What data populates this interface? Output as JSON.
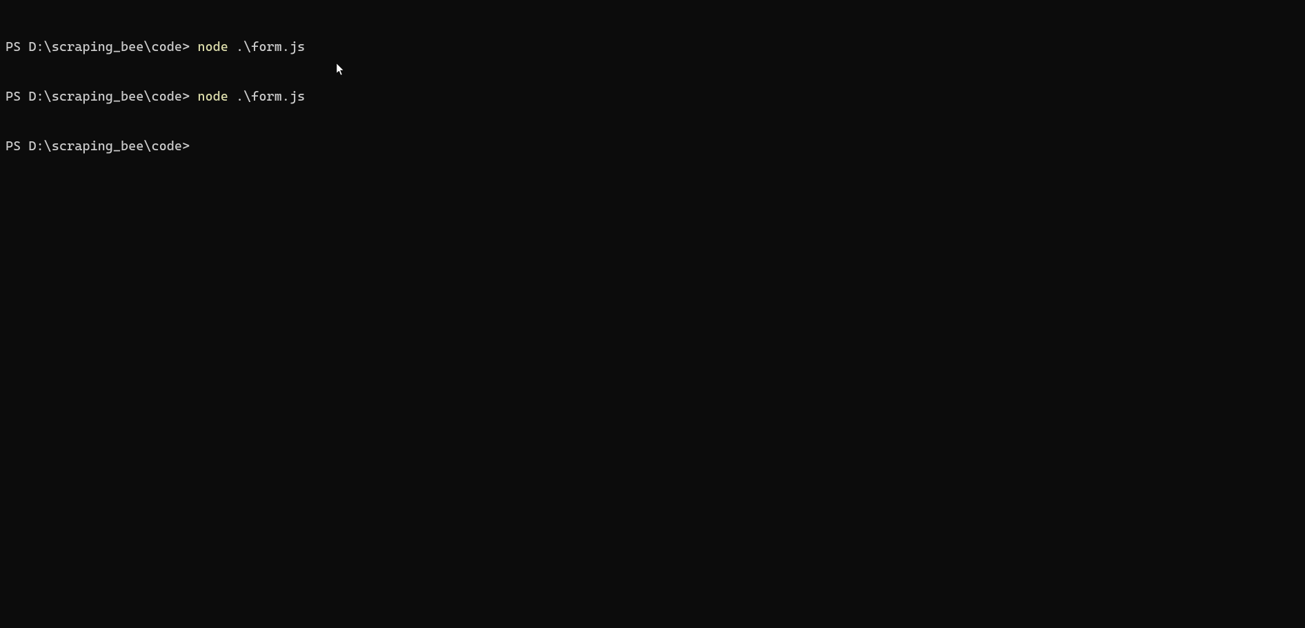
{
  "terminal": {
    "lines": [
      {
        "prompt": "PS D:\\scraping_bee\\code> ",
        "command_exe": "node",
        "command_arg": " .\\form.js"
      },
      {
        "prompt": "PS D:\\scraping_bee\\code> ",
        "command_exe": "node",
        "command_arg": " .\\form.js"
      },
      {
        "prompt": "PS D:\\scraping_bee\\code> ",
        "command_exe": "",
        "command_arg": ""
      }
    ]
  }
}
